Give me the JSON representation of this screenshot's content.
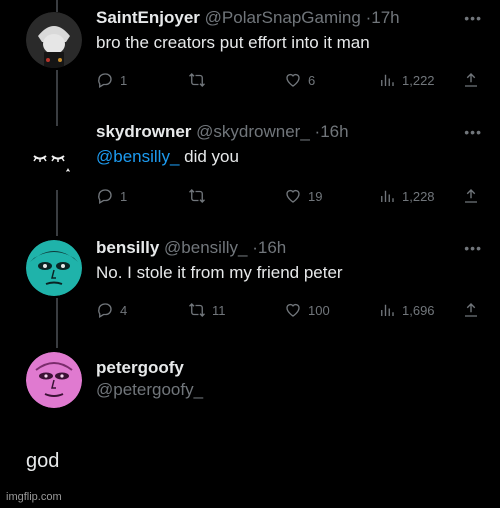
{
  "tweets": [
    {
      "name": "SaintEnjoyer",
      "handle": "@PolarSnapGaming",
      "time": "17h",
      "text": "bro the creators put effort into it man",
      "mention": "",
      "replies": "1",
      "retweets": "",
      "likes": "6",
      "views": "1,222"
    },
    {
      "name": "skydrowner",
      "handle": "@skydrowner_",
      "time": "16h",
      "mention": "@bensilly_",
      "text": " did you",
      "replies": "1",
      "retweets": "",
      "likes": "19",
      "views": "1,228"
    },
    {
      "name": "bensilly",
      "handle": "@bensilly_",
      "time": "16h",
      "text": "No. I stole it from my friend peter",
      "mention": "",
      "replies": "4",
      "retweets": "11",
      "likes": "100",
      "views": "1,696"
    }
  ],
  "profile": {
    "name": "petergoofy",
    "handle": "@petergoofy_"
  },
  "caption": "god",
  "watermark": "imgflip.com",
  "colors": {
    "background": "#000000",
    "mention": "#1d9bf0",
    "muted": "#71767b"
  },
  "icons": {
    "reply": "reply-icon",
    "retweet": "retweet-icon",
    "like": "heart-icon",
    "views": "bar-chart-icon",
    "share": "share-icon",
    "more": "more-icon"
  }
}
